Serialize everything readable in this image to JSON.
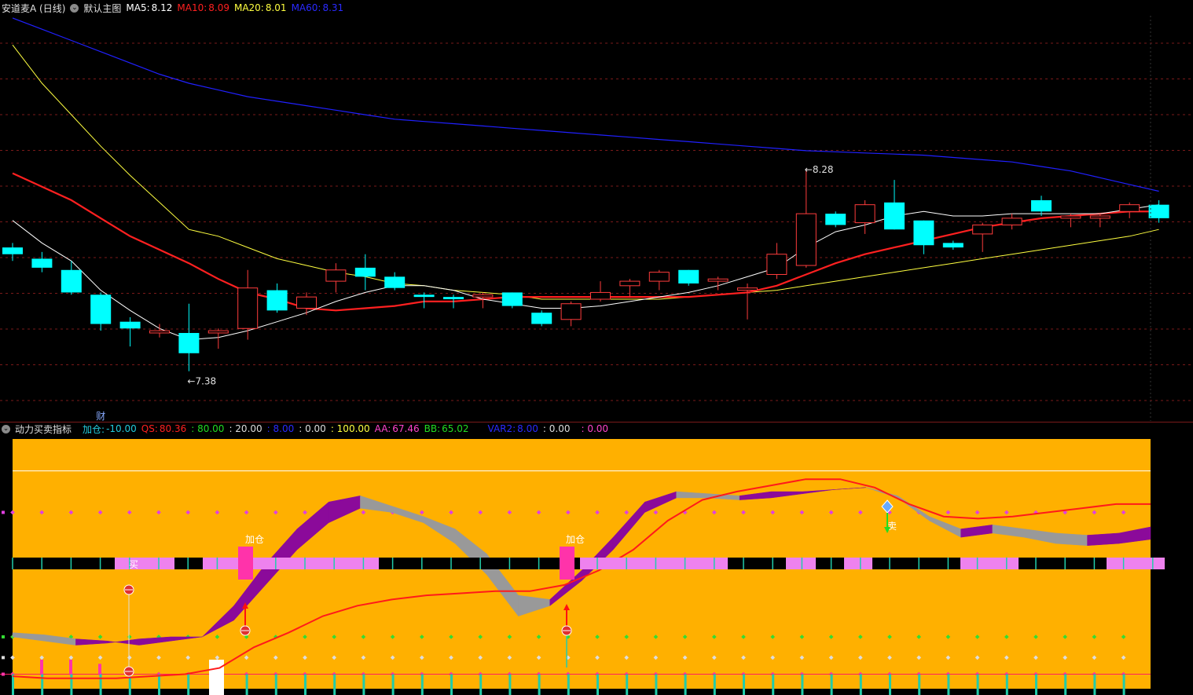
{
  "main_header": {
    "title": "安道麦A (日线)",
    "template_label": "默认主图",
    "ma5_label": "MA5:",
    "ma5_value": "8.12",
    "ma10_label": "MA10:",
    "ma10_value": "8.09",
    "ma20_label": "MA20:",
    "ma20_value": "8.01",
    "ma60_label": "MA60:",
    "ma60_value": "8.31",
    "collapse_icon": "chevron-circle-icon"
  },
  "sub_header": {
    "title": "动力买卖指标",
    "jiacang_label": "加仓:",
    "jiacang_value": "-10.00",
    "qs_label": "QS:",
    "qs_value": "80.36",
    "v80": ": 80.00",
    "v20": ": 20.00",
    "v_blue": ": 8.00",
    "v_zero1": ": 0.00",
    "v100": ": 100.00",
    "aa_label": "AA:",
    "aa_value": "67.46",
    "bb_label": "BB:",
    "bb_value": "65.02",
    "var2_label": "VAR2:",
    "var2_value": "8.00",
    "v_zero2": ": 0.00",
    "v_zero3": ": 0.00"
  },
  "colors": {
    "up": "#ff3c3c",
    "down": "#00ffff",
    "ma5": "#ffffff",
    "ma10": "#ff2020",
    "ma20": "#ffff40",
    "ma60": "#2020ff",
    "panel_bg": "#ffb000",
    "grid": "#7a1a1a",
    "purple": "#8b0a9a",
    "gray": "#999999",
    "pink": "#ee82ee",
    "magenta": "#ff33aa",
    "teal": "#22ccaa"
  },
  "chart_data": [
    {
      "type": "candlestick",
      "title": "安道麦A (日线)",
      "annotations": [
        {
          "text": "←7.38",
          "candle": 6
        },
        {
          "text": "←8.28",
          "candle": 27
        },
        {
          "text": "财",
          "candle": 3
        }
      ],
      "ylim": [
        7.18,
        8.96
      ],
      "candles": [
        {
          "o": 7.93,
          "h": 7.95,
          "l": 7.87,
          "c": 7.9
        },
        {
          "o": 7.88,
          "h": 7.91,
          "l": 7.82,
          "c": 7.84
        },
        {
          "o": 7.83,
          "h": 7.87,
          "l": 7.72,
          "c": 7.73
        },
        {
          "o": 7.72,
          "h": 7.73,
          "l": 7.56,
          "c": 7.59
        },
        {
          "o": 7.6,
          "h": 7.62,
          "l": 7.49,
          "c": 7.57
        },
        {
          "o": 7.55,
          "h": 7.59,
          "l": 7.53,
          "c": 7.56
        },
        {
          "o": 7.55,
          "h": 7.68,
          "l": 7.38,
          "c": 7.46
        },
        {
          "o": 7.55,
          "h": 7.57,
          "l": 7.48,
          "c": 7.56
        },
        {
          "o": 7.57,
          "h": 7.83,
          "l": 7.52,
          "c": 7.75
        },
        {
          "o": 7.74,
          "h": 7.77,
          "l": 7.64,
          "c": 7.65
        },
        {
          "o": 7.66,
          "h": 7.73,
          "l": 7.63,
          "c": 7.71
        },
        {
          "o": 7.78,
          "h": 7.86,
          "l": 7.73,
          "c": 7.83
        },
        {
          "o": 7.84,
          "h": 7.9,
          "l": 7.74,
          "c": 7.8
        },
        {
          "o": 7.8,
          "h": 7.82,
          "l": 7.74,
          "c": 7.75
        },
        {
          "o": 7.72,
          "h": 7.73,
          "l": 7.66,
          "c": 7.71
        },
        {
          "o": 7.71,
          "h": 7.72,
          "l": 7.66,
          "c": 7.7
        },
        {
          "o": 7.71,
          "h": 7.73,
          "l": 7.66,
          "c": 7.72
        },
        {
          "o": 7.73,
          "h": 7.73,
          "l": 7.66,
          "c": 7.67
        },
        {
          "o": 7.64,
          "h": 7.65,
          "l": 7.58,
          "c": 7.59
        },
        {
          "o": 7.61,
          "h": 7.69,
          "l": 7.58,
          "c": 7.68
        },
        {
          "o": 7.7,
          "h": 7.78,
          "l": 7.69,
          "c": 7.73
        },
        {
          "o": 7.76,
          "h": 7.79,
          "l": 7.71,
          "c": 7.78
        },
        {
          "o": 7.78,
          "h": 7.83,
          "l": 7.74,
          "c": 7.82
        },
        {
          "o": 7.83,
          "h": 7.83,
          "l": 7.76,
          "c": 7.77
        },
        {
          "o": 7.78,
          "h": 7.8,
          "l": 7.74,
          "c": 7.79
        },
        {
          "o": 7.74,
          "h": 7.77,
          "l": 7.61,
          "c": 7.75
        },
        {
          "o": 7.81,
          "h": 7.95,
          "l": 7.79,
          "c": 7.9
        },
        {
          "o": 7.85,
          "h": 8.28,
          "l": 7.84,
          "c": 8.08
        },
        {
          "o": 8.08,
          "h": 8.09,
          "l": 8.02,
          "c": 8.03
        },
        {
          "o": 8.04,
          "h": 8.14,
          "l": 7.99,
          "c": 8.12
        },
        {
          "o": 8.13,
          "h": 8.23,
          "l": 8.01,
          "c": 8.01
        },
        {
          "o": 8.05,
          "h": 8.05,
          "l": 7.9,
          "c": 7.94
        },
        {
          "o": 7.95,
          "h": 7.96,
          "l": 7.92,
          "c": 7.93
        },
        {
          "o": 7.99,
          "h": 8.04,
          "l": 7.91,
          "c": 8.03
        },
        {
          "o": 8.03,
          "h": 8.08,
          "l": 8.01,
          "c": 8.06
        },
        {
          "o": 8.14,
          "h": 8.16,
          "l": 8.07,
          "c": 8.09
        },
        {
          "o": 8.06,
          "h": 8.08,
          "l": 8.02,
          "c": 8.07
        },
        {
          "o": 8.06,
          "h": 8.08,
          "l": 8.02,
          "c": 8.07
        },
        {
          "o": 8.09,
          "h": 8.13,
          "l": 8.06,
          "c": 8.12
        },
        {
          "o": 8.12,
          "h": 8.14,
          "l": 8.04,
          "c": 8.06
        }
      ],
      "ma5": [
        8.05,
        7.95,
        7.87,
        7.74,
        7.65,
        7.57,
        7.52,
        7.53,
        7.56,
        7.6,
        7.64,
        7.69,
        7.73,
        7.76,
        7.76,
        7.74,
        7.7,
        7.68,
        7.66,
        7.66,
        7.67,
        7.69,
        7.71,
        7.73,
        7.76,
        7.8,
        7.84,
        7.93,
        8.0,
        8.03,
        8.07,
        8.09,
        8.07,
        8.07,
        8.08,
        8.08,
        8.08,
        8.08,
        8.1,
        8.12
      ],
      "ma10": [
        8.26,
        8.2,
        8.14,
        8.06,
        7.98,
        7.92,
        7.86,
        7.79,
        7.73,
        7.7,
        7.66,
        7.65,
        7.66,
        7.67,
        7.69,
        7.69,
        7.7,
        7.71,
        7.71,
        7.71,
        7.71,
        7.71,
        7.71,
        7.71,
        7.72,
        7.73,
        7.76,
        7.81,
        7.86,
        7.9,
        7.93,
        7.96,
        7.99,
        8.02,
        8.04,
        8.06,
        8.07,
        8.08,
        8.09,
        8.09
      ],
      "ma20": [
        8.83,
        8.66,
        8.52,
        8.38,
        8.25,
        8.13,
        8.01,
        7.98,
        7.93,
        7.88,
        7.85,
        7.82,
        7.8,
        7.77,
        7.76,
        7.74,
        7.73,
        7.72,
        7.7,
        7.7,
        7.7,
        7.7,
        7.7,
        7.71,
        7.72,
        7.73,
        7.74,
        7.76,
        7.78,
        7.8,
        7.82,
        7.84,
        7.86,
        7.88,
        7.9,
        7.92,
        7.94,
        7.96,
        7.98,
        8.01
      ],
      "ma60": [
        8.95,
        8.9,
        8.85,
        8.8,
        8.75,
        8.7,
        8.66,
        8.63,
        8.6,
        8.58,
        8.56,
        8.54,
        8.52,
        8.5,
        8.49,
        8.48,
        8.47,
        8.46,
        8.45,
        8.44,
        8.43,
        8.42,
        8.41,
        8.4,
        8.39,
        8.38,
        8.37,
        8.36,
        8.355,
        8.35,
        8.345,
        8.34,
        8.33,
        8.32,
        8.31,
        8.29,
        8.27,
        8.24,
        8.21,
        8.18
      ]
    },
    {
      "type": "indicator",
      "title": "动力买卖指标",
      "ylim": [
        -5,
        115
      ],
      "levels": [
        0,
        20,
        80,
        100
      ],
      "series": [
        {
          "name": "AA",
          "values": [
            20,
            18,
            16,
            17,
            19,
            20,
            20,
            35,
            55,
            72,
            85,
            88,
            83,
            78,
            72,
            60,
            40,
            38,
            52,
            68,
            85,
            90,
            89,
            88,
            90,
            90,
            91,
            92,
            88,
            78,
            72,
            74,
            72,
            70,
            69,
            70,
            73
          ]
        },
        {
          "name": "BB",
          "values": [
            22,
            21,
            19,
            18,
            16,
            18,
            20,
            28,
            45,
            62,
            75,
            82,
            80,
            75,
            65,
            50,
            30,
            35,
            47,
            62,
            80,
            87,
            87,
            86,
            87,
            89,
            91,
            92,
            87,
            76,
            68,
            70,
            68,
            65,
            64,
            65,
            67
          ]
        },
        {
          "name": "QS",
          "values": [
            1,
            0,
            0,
            0,
            1,
            2,
            5,
            15,
            22,
            30,
            35,
            38,
            40,
            41,
            42,
            42,
            45,
            52,
            62,
            76,
            86,
            90,
            93,
            96,
            96,
            92,
            84,
            78,
            77,
            78,
            80,
            82,
            84,
            84
          ]
        }
      ],
      "labels": [
        "加仓",
        "买",
        "卖",
        "加仓"
      ]
    }
  ]
}
